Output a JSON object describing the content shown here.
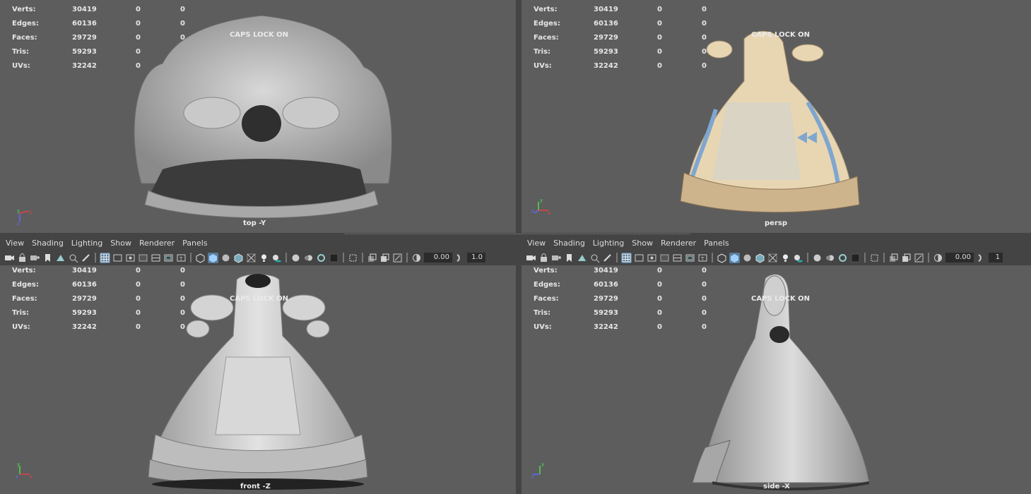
{
  "hud": {
    "rows": [
      {
        "label": "Verts:",
        "v1": "30419",
        "v2": "0",
        "v3": "0"
      },
      {
        "label": "Edges:",
        "v1": "60136",
        "v2": "0",
        "v3": "0"
      },
      {
        "label": "Faces:",
        "v1": "29729",
        "v2": "0",
        "v3": "0"
      },
      {
        "label": "Tris:",
        "v1": "59293",
        "v2": "0",
        "v3": "0"
      },
      {
        "label": "UVs:",
        "v1": "32242",
        "v2": "0",
        "v3": "0"
      }
    ]
  },
  "caps_lock": "CAPS LOCK ON",
  "viewports": {
    "top": {
      "camera": "top -Y"
    },
    "persp": {
      "camera": "persp"
    },
    "front": {
      "camera": "front -Z"
    },
    "side": {
      "camera": "side -X"
    }
  },
  "menu": [
    "View",
    "Shading",
    "Lighting",
    "Show",
    "Renderer",
    "Panels"
  ],
  "toolbar": {
    "exposure": "0.00",
    "gamma": "1.0",
    "gamma_right": "1"
  },
  "axis": {
    "x": "x",
    "y": "y",
    "z": "z"
  },
  "colors": {
    "viewport_bg": "#5d5d5d",
    "panel_bg": "#444444",
    "selected_icon": "#5b7d9c",
    "dress_fabric": "#e8d6b3",
    "ribbon": "#7fa6cf"
  },
  "icons": [
    "camera-icon",
    "bookmark-icon",
    "grid-icon",
    "wireframe-icon",
    "smooth-shade-icon",
    "textured-icon",
    "lighting-icon",
    "isolate-icon",
    "xray-icon",
    "exposure-icon",
    "gamma-icon"
  ]
}
